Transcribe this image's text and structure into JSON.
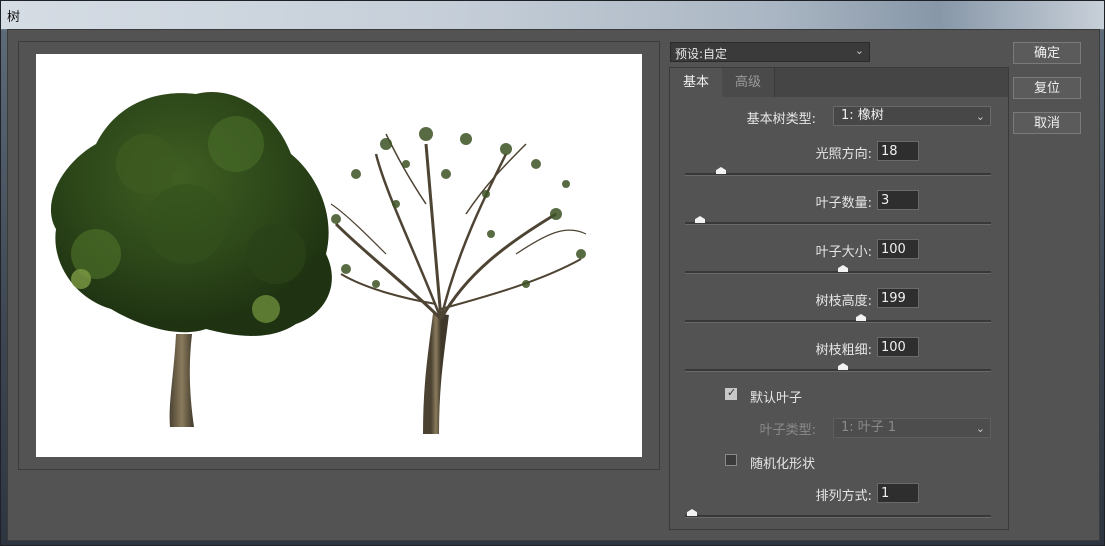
{
  "window": {
    "title": "树"
  },
  "preset": {
    "label": "预设:",
    "value": "自定"
  },
  "tabs": [
    {
      "label": "基本"
    },
    {
      "label": "高级"
    }
  ],
  "controls": {
    "tree_type": {
      "label": "基本树类型:",
      "value": "1: 橡树"
    },
    "light_direction": {
      "label": "光照方向:",
      "value": "18",
      "slider_fraction": 0.1
    },
    "leaf_count": {
      "label": "叶子数量:",
      "value": "3",
      "slider_fraction": 0.03
    },
    "leaf_size": {
      "label": "叶子大小:",
      "value": "100",
      "slider_fraction": 0.5
    },
    "branch_height": {
      "label": "树枝高度:",
      "value": "199",
      "slider_fraction": 0.56
    },
    "branch_thickness": {
      "label": "树枝粗细:",
      "value": "100",
      "slider_fraction": 0.5
    },
    "default_leaves": {
      "label": "默认叶子",
      "checked": true
    },
    "leaf_type": {
      "label": "叶子类型:",
      "value": "1: 叶子 1",
      "disabled": true
    },
    "randomize": {
      "label": "随机化形状",
      "checked": false
    },
    "arrangement": {
      "label": "排列方式:",
      "value": "1",
      "slider_fraction": 0.0
    }
  },
  "buttons": {
    "ok": "确定",
    "reset": "复位",
    "cancel": "取消"
  },
  "colors": {
    "panel_bg": "#535353",
    "preview_bg": "#ffffff",
    "foliage_dark": "#2f4a1c",
    "foliage_light": "#6b8c3a",
    "trunk": "#6d6047"
  },
  "icons": {
    "dropdown": "chevron-down-icon",
    "checkbox": "checkmark-icon"
  }
}
